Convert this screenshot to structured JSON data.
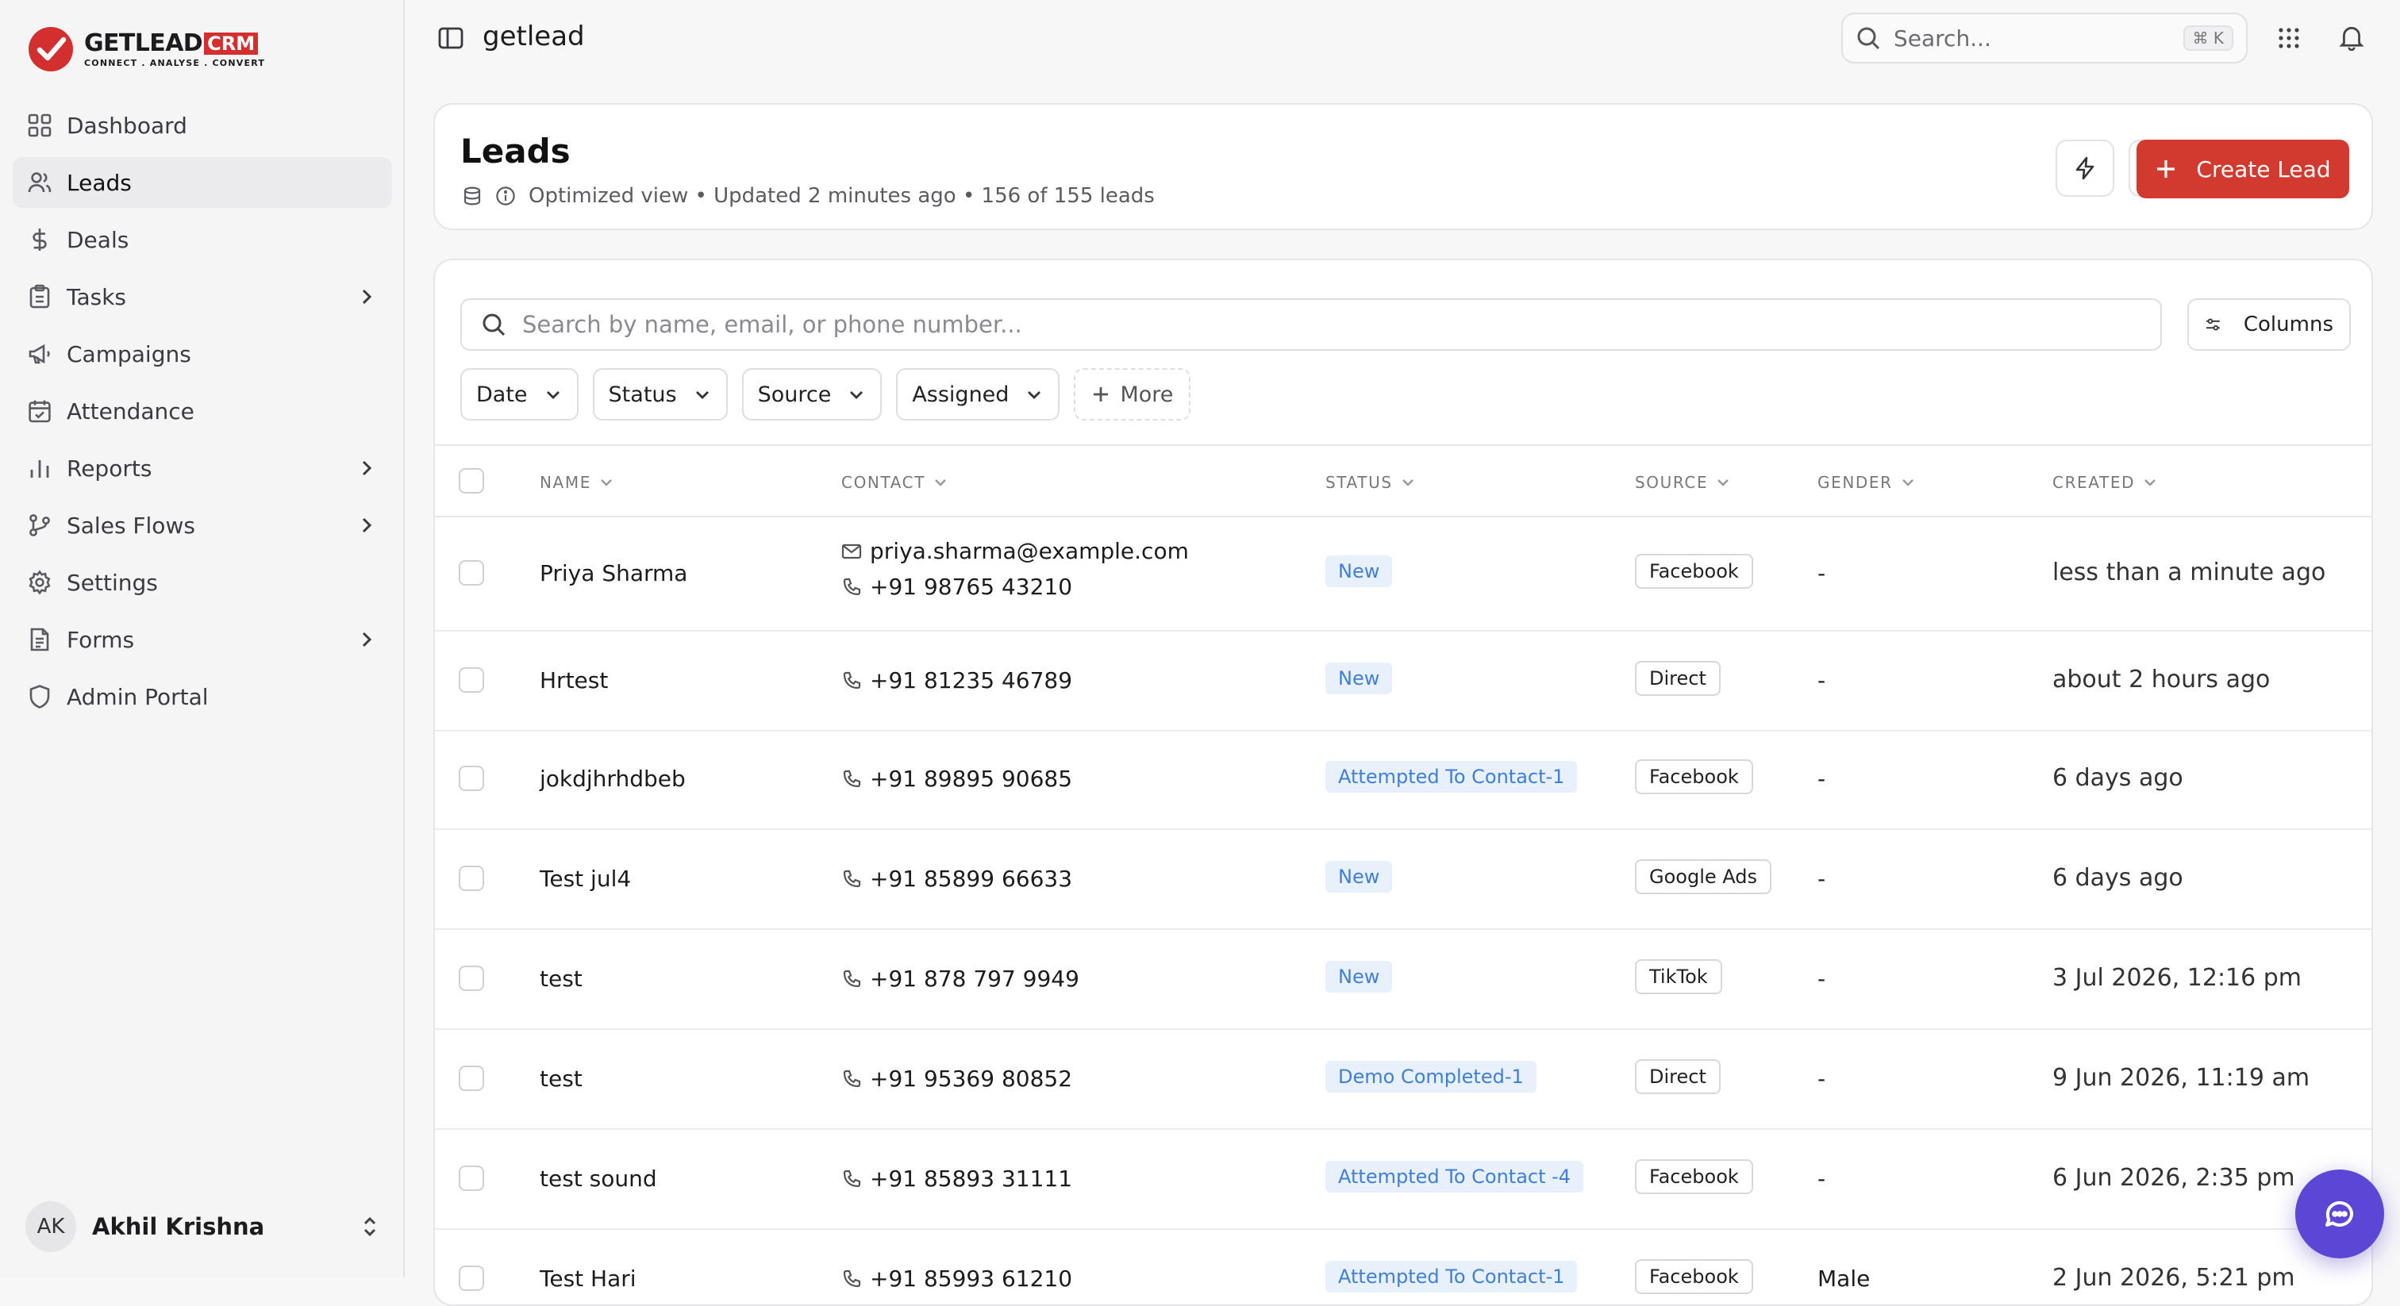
{
  "brand": {
    "name": "GETLEAD",
    "badge": "CRM",
    "tagline": "CONNECT . ANALYSE . CONVERT",
    "accent": "#d32f2f"
  },
  "sidebar": {
    "items": [
      {
        "label": "Dashboard",
        "icon": "dashboard-icon"
      },
      {
        "label": "Leads",
        "icon": "users-icon",
        "active": true
      },
      {
        "label": "Deals",
        "icon": "dollar-icon"
      },
      {
        "label": "Tasks",
        "icon": "clipboard-icon",
        "expandable": true
      },
      {
        "label": "Campaigns",
        "icon": "megaphone-icon"
      },
      {
        "label": "Attendance",
        "icon": "calendar-check-icon"
      },
      {
        "label": "Reports",
        "icon": "bar-chart-icon",
        "expandable": true
      },
      {
        "label": "Sales Flows",
        "icon": "git-branch-icon",
        "expandable": true
      },
      {
        "label": "Settings",
        "icon": "gear-icon"
      },
      {
        "label": "Forms",
        "icon": "form-icon",
        "expandable": true
      }
    ],
    "admin": {
      "label": "Admin Portal",
      "icon": "shield-icon"
    },
    "user": {
      "initials": "AK",
      "name": "Akhil Krishna"
    }
  },
  "topbar": {
    "workspace": "getlead",
    "search_placeholder": "Search...",
    "shortcut": "⌘ K"
  },
  "header": {
    "title": "Leads",
    "subtitle": "Optimized view • Updated 2 minutes ago • 156 of 155 leads",
    "create_label": "Create Lead",
    "create_color": "#d23a30"
  },
  "toolbar": {
    "search_placeholder": "Search by name, email, or phone number...",
    "columns_label": "Columns",
    "filters": [
      "Date",
      "Status",
      "Source",
      "Assigned"
    ],
    "more_label": "More"
  },
  "table": {
    "columns": [
      "NAME",
      "CONTACT",
      "STATUS",
      "SOURCE",
      "GENDER",
      "CREATED"
    ],
    "rows": [
      {
        "name": "Priya Sharma",
        "email": "priya.sharma@example.com",
        "phone": "+91 98765 43210",
        "status": "New",
        "source": "Facebook",
        "gender": "-",
        "created": "less than a minute ago"
      },
      {
        "name": "Hrtest",
        "email": "",
        "phone": "+91 81235 46789",
        "status": "New",
        "source": "Direct",
        "gender": "-",
        "created": "about 2 hours ago"
      },
      {
        "name": "jokdjhrhdbeb",
        "email": "",
        "phone": "+91 89895 90685",
        "status": "Attempted To Contact-1",
        "source": "Facebook",
        "gender": "-",
        "created": "6 days ago"
      },
      {
        "name": "Test jul4",
        "email": "",
        "phone": "+91 85899 66633",
        "status": "New",
        "source": "Google Ads",
        "gender": "-",
        "created": "6 days ago"
      },
      {
        "name": "test",
        "email": "",
        "phone": "+91 878 797 9949",
        "status": "New",
        "source": "TikTok",
        "gender": "-",
        "created": "3 Jul 2026, 12:16 pm"
      },
      {
        "name": "test",
        "email": "",
        "phone": "+91 95369 80852",
        "status": "Demo Completed-1",
        "source": "Direct",
        "gender": "-",
        "created": "9 Jun 2026, 11:19 am"
      },
      {
        "name": "test sound",
        "email": "",
        "phone": "+91 85893 31111",
        "status": "Attempted To Contact -4",
        "source": "Facebook",
        "gender": "-",
        "created": "6 Jun 2026, 2:35 pm"
      },
      {
        "name": "Test Hari",
        "email": "",
        "phone": "+91 85993 61210",
        "status": "Attempted To Contact-1",
        "source": "Facebook",
        "gender": "Male",
        "created": "2 Jun 2026, 5:21 pm"
      }
    ]
  },
  "chat": {
    "icon": "chat-icon",
    "color": "#5b46d6"
  }
}
